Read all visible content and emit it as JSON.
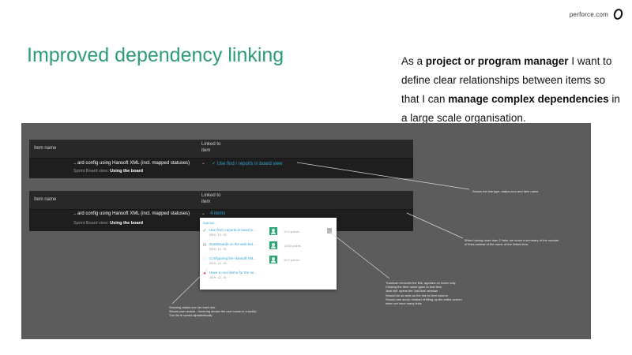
{
  "brand": {
    "url_text": "perforce.com"
  },
  "title": "Improved dependency linking",
  "story": {
    "p1": "As a ",
    "b1": "project or program manager",
    "p2": " I want to define clear relationships between items so that I can ",
    "b2": "manage complex dependencies",
    "p3": " in a large scale organisation."
  },
  "board1": {
    "col_item_name": "Item name",
    "col_linked_to_item": "Linked to item",
    "row_text": ".. ard config using Hansoft XML (incl. mapped statuses)",
    "row_sub_prefix": "Sprint Board view: ",
    "row_sub_bold": "Using the board",
    "link_label": "Use find / reports in board view"
  },
  "board2": {
    "col_item_name": "Item name",
    "col_linked_to_item": "Linked to item",
    "row_text": ".. ard config using Hansoft XML (incl. mapped statuses)",
    "row_sub_prefix": "Sprint Board view: ",
    "row_sub_bold": "Using the board",
    "summary_label": "4 items"
  },
  "popup": {
    "add_link": "Add link...",
    "items": [
      {
        "label": "Use find / reports in board v...",
        "date": "2019 - 12 - 01",
        "points": "12.0 points",
        "status": "done",
        "status_icon": "check-icon",
        "status_color": "#2eaa5c"
      },
      {
        "label": "Dashboards on the web bet...",
        "date": "2019 - 12 - 01",
        "points": "12/00 points",
        "status": "blocked",
        "status_icon": "minus-circle-icon",
        "status_color": "#999999"
      },
      {
        "label": "Configuring the Hansoft XM...",
        "date": "2019 - 12 - 01",
        "points": "19.0 points",
        "status": "in-progress",
        "status_icon": "dotted-circle-icon",
        "status_color": "#2ea2d8"
      },
      {
        "label": "Have a cool demo for the se...",
        "date": "2019 - 12 - 01",
        "points": "",
        "status": "high-priority",
        "status_icon": "dot-icon",
        "status_color": "#e23b6a"
      }
    ]
  },
  "notes": {
    "link_type": "Shows the link type, status icon and item name.",
    "summary": [
      "When having more than 2 links, we show a summary of the number",
      "of links instead of the name of the linked item."
    ],
    "trashcan": [
      "Trashcan removes the link, appears on hover only",
      "Clicking the item name goes to that item",
      "'Add link' opens the 'Add link' window",
      "Should be as wide as the link to item column",
      "Should use scroll, instead of filling up the entire screen",
      "when we have many links"
    ],
    "status": [
      "Showing status icon for each link.",
      "Shows user avatar - hovering shows the user name in a tooltip.",
      "The list is sorted alphabetically"
    ]
  },
  "colors": {
    "accent_green": "#2e9d74",
    "link_blue": "#2ea2d8",
    "stage_bg": "#5c5c5c",
    "board_bg": "#1e1e1e"
  }
}
